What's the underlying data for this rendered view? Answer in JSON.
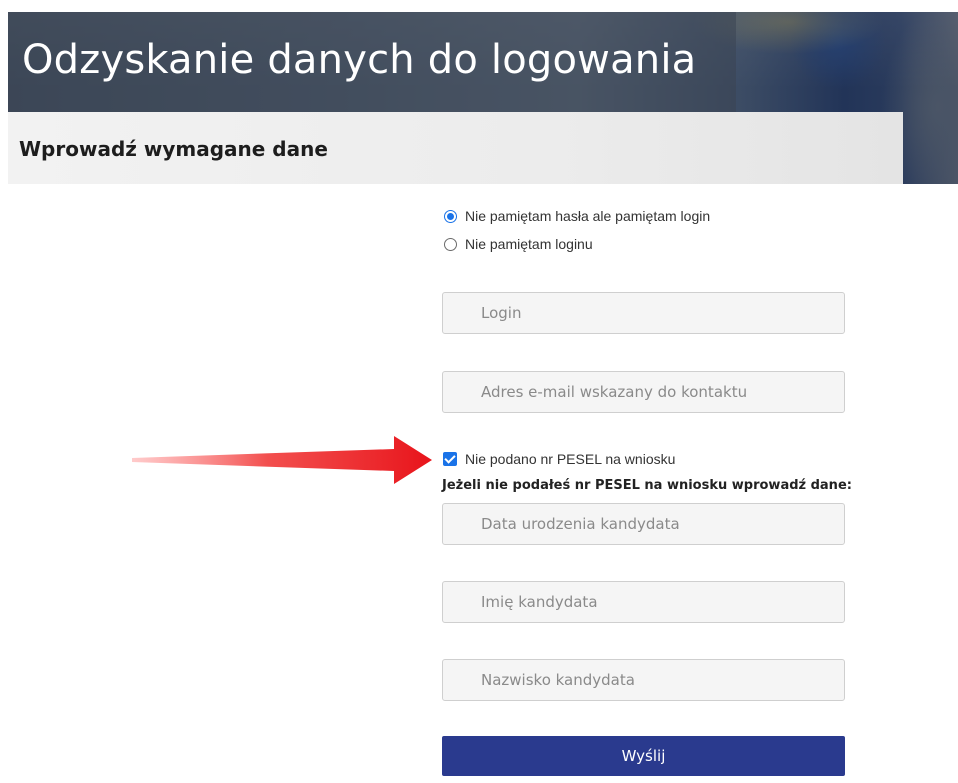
{
  "header": {
    "title": "Odzyskanie danych do logowania",
    "subtitle": "Wprowadź wymagane dane"
  },
  "form": {
    "recovery_options": [
      {
        "label": "Nie pamiętam hasła ale pamiętam login",
        "selected": true
      },
      {
        "label": "Nie pamiętam loginu",
        "selected": false
      }
    ],
    "login_placeholder": "Login",
    "email_placeholder": "Adres e-mail wskazany do kontaktu",
    "no_pesel_checkbox": {
      "label": "Nie podano nr PESEL na wniosku",
      "checked": true
    },
    "pesel_hint": "Jeżeli nie podałeś nr PESEL na wniosku wprowadź dane:",
    "birth_date_placeholder": "Data urodzenia kandydata",
    "first_name_placeholder": "Imię kandydata",
    "last_name_placeholder": "Nazwisko kandydata",
    "submit_label": "Wyślij"
  },
  "annotation": {
    "arrow_icon": "red-arrow-icon",
    "arrow_color": "#e8141b"
  },
  "colors": {
    "accent": "#1a73e8",
    "submit_button": "#2a3a8e"
  }
}
